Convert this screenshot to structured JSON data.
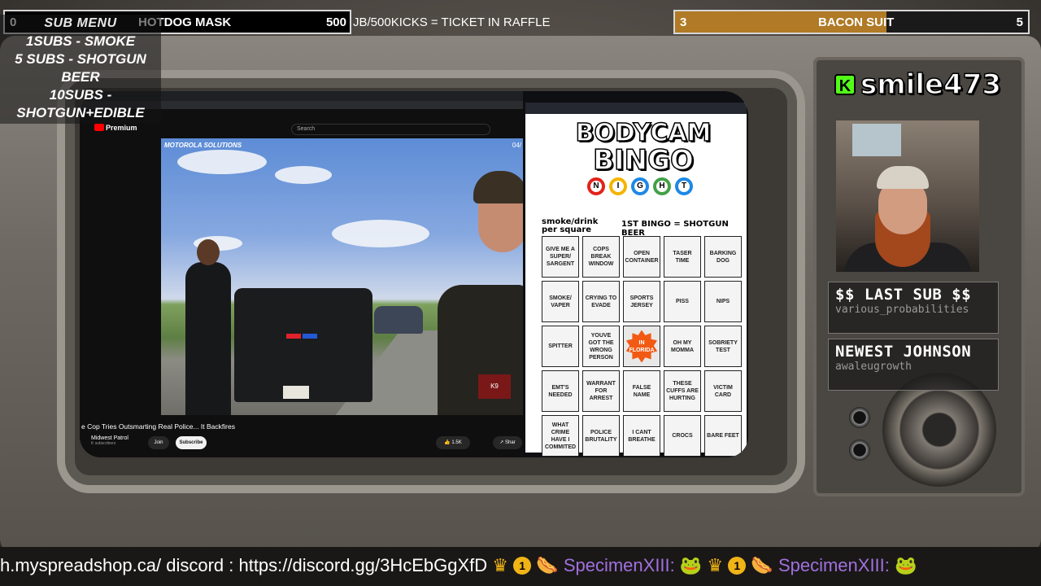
{
  "top_bars": {
    "left": {
      "start": "0",
      "title": "HOTDOG MASK",
      "goal": "500"
    },
    "ticker": "JB/500KICKS = TICKET IN RAFFLE",
    "right": {
      "start": "3",
      "title": "BACON SUIT",
      "goal": "5",
      "progress_fraction": 0.6
    }
  },
  "submenu": {
    "heading": "SUB MENU",
    "items": [
      "1SUBS   - SMOKE",
      "5 SUBS  - SHOTGUN BEER",
      "10SUBS - SHOTGUN+EDIBLE"
    ]
  },
  "browser": {
    "logo": "Premium",
    "search_placeholder": "Search",
    "video_brand": "MOTOROLA SOLUTIONS",
    "video_date": "04/",
    "video_title": "e Cop Tries Outsmarting Real Police... It Backfires",
    "channel": "Midwest Patrol",
    "channel_subs": "K subscribers",
    "join": "Join",
    "subscribe": "Subscribe",
    "likes": "1.5K",
    "share": "Shar",
    "k9": "K9",
    "plate": "S32-26"
  },
  "bingo": {
    "title_line1": "BODYCAM",
    "title_line2": "BINGO",
    "night_letters": [
      "N",
      "I",
      "G",
      "H",
      "T"
    ],
    "night_colors": [
      "#e2231a",
      "#f4b400",
      "#1e88e5",
      "#43a047",
      "#1e88e5"
    ],
    "per_square": "smoke/drink\nper square",
    "rule": "1ST BINGO = SHOTGUN BEER",
    "cells": [
      "GIVE ME A SUPER/ SARGENT",
      "COPS BREAK WINDOW",
      "OPEN CONTAINER",
      "TASER TIME",
      "BARKING DOG",
      "SMOKE/ VAPER",
      "CRYING TO EVADE",
      "SPORTS JERSEY",
      "PISS",
      "NIPS",
      "SPITTER",
      "YOUVE GOT THE WRONG PERSON",
      "IN FLORIDA",
      "OH MY MOMMA",
      "SOBRIETY TEST",
      "EMT'S NEEDED",
      "WARRANT FOR ARREST",
      "FALSE NAME",
      "THESE CUFFS ARE HURTING",
      "VICTIM CARD",
      "WHAT CRIME HAVE I COMMITED",
      "POLICE BRUTALITY",
      "I CANT BREATHE",
      "CROCS",
      "BARE FEET"
    ]
  },
  "streamer": {
    "name": "smile473",
    "platform_icon": "kick-logo-icon",
    "platform_letter": "K"
  },
  "panels": {
    "last_sub": {
      "heading": "$$ LAST SUB $$",
      "value": "various_probabilities"
    },
    "newest": {
      "heading": "NEWEST JOHNSON",
      "value": "awaleugrowth"
    }
  },
  "bottom_ticker": {
    "text_prefix": "h.myspreadshop.ca/ discord : https://discord.gg/3HcEbGgXfD ",
    "badge": "1",
    "user1": "SpecimenXIII:",
    "user2": "SpecimenXIII:"
  }
}
